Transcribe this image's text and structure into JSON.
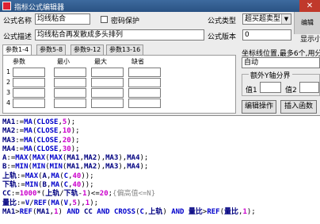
{
  "window": {
    "title": "指标公式编辑器",
    "close_label": "✕",
    "side_label": "编辑"
  },
  "form": {
    "name_label": "公式名称",
    "name_value": "均线粘合",
    "password_label": "密码保护",
    "desc_label": "公式描述",
    "desc_value": "均线粘合再发散成多头排列",
    "type_label": "公式类型",
    "type_value": "超买超卖型",
    "version_label": "公式版本",
    "version_value": "0",
    "show_label": "显示小"
  },
  "tabs": [
    "参数1-4",
    "参数5-8",
    "参数9-12",
    "参数13-16"
  ],
  "param_headers": [
    "参数",
    "最小",
    "最大",
    "缺省"
  ],
  "param_rows": [
    "1",
    "2",
    "3",
    "4"
  ],
  "right_panel": {
    "coord_label": "坐标线位置,最多6个,用分",
    "coord_value": "自动",
    "extra_axis_label": "额外Y轴分界",
    "val1_label": "值1",
    "val2_label": "值2",
    "edit_btn": "编辑操作",
    "insert_btn": "插入函数"
  },
  "code_lines": [
    [
      {
        "t": "MA1",
        "c": "var"
      },
      {
        "t": ":=",
        "c": ""
      },
      {
        "t": "MA",
        "c": "fn"
      },
      {
        "t": "(",
        "c": ""
      },
      {
        "t": "CLOSE",
        "c": "fn"
      },
      {
        "t": ",",
        "c": ""
      },
      {
        "t": "5",
        "c": "num"
      },
      {
        "t": ");",
        "c": ""
      }
    ],
    [
      {
        "t": "MA2",
        "c": "var"
      },
      {
        "t": ":=",
        "c": ""
      },
      {
        "t": "MA",
        "c": "fn"
      },
      {
        "t": "(",
        "c": ""
      },
      {
        "t": "CLOSE",
        "c": "fn"
      },
      {
        "t": ",",
        "c": ""
      },
      {
        "t": "10",
        "c": "num"
      },
      {
        "t": ");",
        "c": ""
      }
    ],
    [
      {
        "t": "MA3",
        "c": "var"
      },
      {
        "t": ":=",
        "c": ""
      },
      {
        "t": "MA",
        "c": "fn"
      },
      {
        "t": "(",
        "c": ""
      },
      {
        "t": "CLOSE",
        "c": "fn"
      },
      {
        "t": ",",
        "c": ""
      },
      {
        "t": "20",
        "c": "num"
      },
      {
        "t": ");",
        "c": ""
      }
    ],
    [
      {
        "t": "MA4",
        "c": "var"
      },
      {
        "t": ":=",
        "c": ""
      },
      {
        "t": "MA",
        "c": "fn"
      },
      {
        "t": "(",
        "c": ""
      },
      {
        "t": "CLOSE",
        "c": "fn"
      },
      {
        "t": ",",
        "c": ""
      },
      {
        "t": "30",
        "c": "num"
      },
      {
        "t": ");",
        "c": ""
      }
    ],
    [
      {
        "t": "A",
        "c": "var"
      },
      {
        "t": ":=",
        "c": ""
      },
      {
        "t": "MAX",
        "c": "fn"
      },
      {
        "t": "(",
        "c": ""
      },
      {
        "t": "MAX",
        "c": "fn"
      },
      {
        "t": "(",
        "c": ""
      },
      {
        "t": "MAX",
        "c": "fn"
      },
      {
        "t": "(",
        "c": ""
      },
      {
        "t": "MA1",
        "c": "var"
      },
      {
        "t": ",",
        "c": ""
      },
      {
        "t": "MA2",
        "c": "var"
      },
      {
        "t": "),",
        "c": ""
      },
      {
        "t": "MA3",
        "c": "var"
      },
      {
        "t": "),",
        "c": ""
      },
      {
        "t": "MA4",
        "c": "var"
      },
      {
        "t": ");",
        "c": ""
      }
    ],
    [
      {
        "t": "B",
        "c": "var"
      },
      {
        "t": ":=",
        "c": ""
      },
      {
        "t": "MIN",
        "c": "fn"
      },
      {
        "t": "(",
        "c": ""
      },
      {
        "t": "MIN",
        "c": "fn"
      },
      {
        "t": "(",
        "c": ""
      },
      {
        "t": "MIN",
        "c": "fn"
      },
      {
        "t": "(",
        "c": ""
      },
      {
        "t": "MA1",
        "c": "var"
      },
      {
        "t": ",",
        "c": ""
      },
      {
        "t": "MA2",
        "c": "var"
      },
      {
        "t": "),",
        "c": ""
      },
      {
        "t": "MA3",
        "c": "var"
      },
      {
        "t": "),",
        "c": ""
      },
      {
        "t": "MA4",
        "c": "var"
      },
      {
        "t": ");",
        "c": ""
      }
    ],
    [
      {
        "t": "上轨",
        "c": "cn"
      },
      {
        "t": ":=",
        "c": ""
      },
      {
        "t": "MAX",
        "c": "fn"
      },
      {
        "t": "(",
        "c": ""
      },
      {
        "t": "A",
        "c": "var"
      },
      {
        "t": ",",
        "c": ""
      },
      {
        "t": "MA",
        "c": "fn"
      },
      {
        "t": "(",
        "c": ""
      },
      {
        "t": "C",
        "c": "fn"
      },
      {
        "t": ",",
        "c": ""
      },
      {
        "t": "40",
        "c": "num"
      },
      {
        "t": "));",
        "c": ""
      }
    ],
    [
      {
        "t": "下轨",
        "c": "cn"
      },
      {
        "t": ":=",
        "c": ""
      },
      {
        "t": "MIN",
        "c": "fn"
      },
      {
        "t": "(",
        "c": ""
      },
      {
        "t": "B",
        "c": "var"
      },
      {
        "t": ",",
        "c": ""
      },
      {
        "t": "MA",
        "c": "fn"
      },
      {
        "t": "(",
        "c": ""
      },
      {
        "t": "C",
        "c": "fn"
      },
      {
        "t": ",",
        "c": ""
      },
      {
        "t": "40",
        "c": "num"
      },
      {
        "t": "));",
        "c": ""
      }
    ],
    [
      {
        "t": "CC",
        "c": "var"
      },
      {
        "t": ":=",
        "c": ""
      },
      {
        "t": "1000",
        "c": "num"
      },
      {
        "t": "*(",
        "c": ""
      },
      {
        "t": "上轨",
        "c": "cn"
      },
      {
        "t": "/",
        "c": ""
      },
      {
        "t": "下轨",
        "c": "cn"
      },
      {
        "t": "-",
        "c": ""
      },
      {
        "t": "1",
        "c": "num"
      },
      {
        "t": ")<=",
        "c": ""
      },
      {
        "t": "20",
        "c": "num"
      },
      {
        "t": ";",
        "c": ""
      },
      {
        "t": "{偏高值<=N}",
        "c": "cmt"
      }
    ],
    [
      {
        "t": "量比",
        "c": "cn"
      },
      {
        "t": ":=",
        "c": ""
      },
      {
        "t": "V",
        "c": "fn"
      },
      {
        "t": "/",
        "c": ""
      },
      {
        "t": "REF",
        "c": "fn"
      },
      {
        "t": "(",
        "c": ""
      },
      {
        "t": "MA",
        "c": "fn"
      },
      {
        "t": "(",
        "c": ""
      },
      {
        "t": "V",
        "c": "fn"
      },
      {
        "t": ",",
        "c": ""
      },
      {
        "t": "5",
        "c": "num"
      },
      {
        "t": "),",
        "c": ""
      },
      {
        "t": "1",
        "c": "num"
      },
      {
        "t": ");",
        "c": ""
      }
    ],
    [
      {
        "t": "MA1",
        "c": "var"
      },
      {
        "t": ">",
        "c": ""
      },
      {
        "t": "REF",
        "c": "fn"
      },
      {
        "t": "(",
        "c": ""
      },
      {
        "t": "MA1",
        "c": "var"
      },
      {
        "t": ",",
        "c": ""
      },
      {
        "t": "1",
        "c": "num"
      },
      {
        "t": ") ",
        "c": ""
      },
      {
        "t": "AND",
        "c": "kw"
      },
      {
        "t": " ",
        "c": ""
      },
      {
        "t": "CC",
        "c": "var"
      },
      {
        "t": " ",
        "c": ""
      },
      {
        "t": "AND",
        "c": "kw"
      },
      {
        "t": " ",
        "c": ""
      },
      {
        "t": "CROSS",
        "c": "fn"
      },
      {
        "t": "(",
        "c": ""
      },
      {
        "t": "C",
        "c": "fn"
      },
      {
        "t": ",",
        "c": ""
      },
      {
        "t": "上轨",
        "c": "cn"
      },
      {
        "t": ") ",
        "c": ""
      },
      {
        "t": "AND",
        "c": "kw"
      },
      {
        "t": " ",
        "c": ""
      },
      {
        "t": "量比",
        "c": "cn"
      },
      {
        "t": ">",
        "c": ""
      },
      {
        "t": "REF",
        "c": "fn"
      },
      {
        "t": "(",
        "c": ""
      },
      {
        "t": "量比",
        "c": "cn"
      },
      {
        "t": ",",
        "c": ""
      },
      {
        "t": "1",
        "c": "num"
      },
      {
        "t": ");",
        "c": ""
      }
    ]
  ]
}
